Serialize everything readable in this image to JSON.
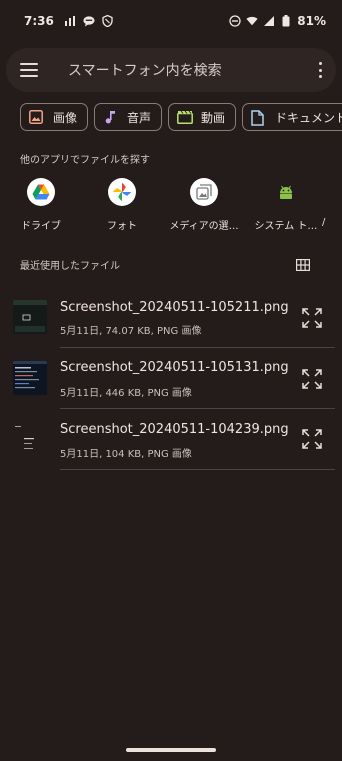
{
  "status_bar": {
    "time": "7:36",
    "battery_percent": "81%",
    "left_icons": [
      "signal-alt-icon",
      "chat-bubble-icon",
      "shield-icon"
    ],
    "right_icons": [
      "dnd-icon",
      "wifi-icon",
      "cell-signal-icon",
      "battery-icon"
    ]
  },
  "search": {
    "placeholder": "スマートフォン内を検索"
  },
  "categories": [
    {
      "label": "画像",
      "icon": "image-icon",
      "color": "#f0a58a"
    },
    {
      "label": "音声",
      "icon": "music-note-icon",
      "color": "#c9a5f0"
    },
    {
      "label": "動画",
      "icon": "clapperboard-icon",
      "color": "#b7e36a"
    },
    {
      "label": "ドキュメント",
      "icon": "document-icon",
      "color": "#a9d6f0"
    }
  ],
  "other_apps": {
    "title": "他のアプリでファイルを探す",
    "apps": [
      {
        "label": "ドライブ",
        "icon": "google-drive-icon"
      },
      {
        "label": "フォト",
        "icon": "google-photos-icon"
      },
      {
        "label": "メディアの選…",
        "icon": "media-picker-icon"
      },
      {
        "label": "システム ト…",
        "icon": "android-icon"
      },
      {
        "label": "/",
        "icon": "partial-app-icon"
      }
    ]
  },
  "recent": {
    "title": "最近使用したファイル",
    "files": [
      {
        "name": "Screenshot_20240511-105211.png",
        "meta": "5月11日, 74.07 KB, PNG 画像"
      },
      {
        "name": "Screenshot_20240511-105131.png",
        "meta": "5月11日, 446 KB, PNG 画像"
      },
      {
        "name": "Screenshot_20240511-104239.png",
        "meta": "5月11日, 104 KB, PNG 画像"
      }
    ]
  },
  "colors": {
    "background": "#231c1a",
    "search_bar": "#2f2624",
    "chip_border": "#8a7b77",
    "divider": "#4d4240"
  }
}
